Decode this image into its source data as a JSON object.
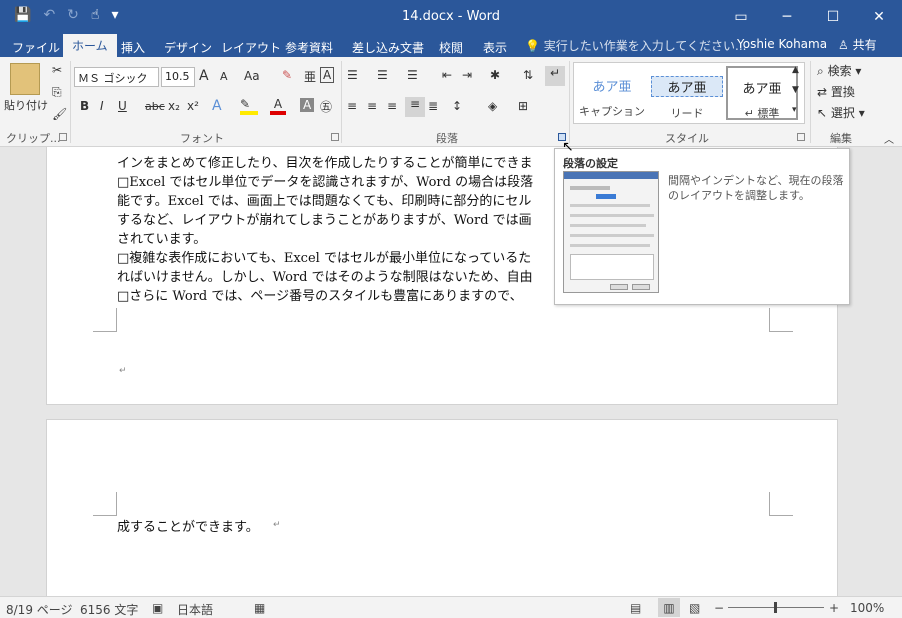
{
  "window": {
    "title": "14.docx - Word",
    "controls": [
      "▭",
      "─",
      "☐",
      "✕"
    ]
  },
  "qat": {
    "save_icon": "💾",
    "undo_icon": "↶",
    "redo_icon": "↻",
    "touch_icon": "☝",
    "customize_icon": "▾"
  },
  "tabs": [
    {
      "label": "ファイル"
    },
    {
      "label": "ホーム"
    },
    {
      "label": "挿入"
    },
    {
      "label": "デザイン"
    },
    {
      "label": "レイアウト"
    },
    {
      "label": "参考資料"
    },
    {
      "label": "差し込み文書"
    },
    {
      "label": "校閲"
    },
    {
      "label": "表示"
    }
  ],
  "tellme": "💡 実行したい作業を入力してください...",
  "user": "Yoshie Kohama",
  "share": "♙ 共有",
  "ribbon": {
    "clipboard": {
      "paste": "貼り付け",
      "label": "クリップ..."
    },
    "font": {
      "name": "ＭＳ ゴシック",
      "size": "10.5",
      "label": "フォント",
      "grow": "A",
      "shrink": "A",
      "case": "Aa",
      "bold": "B",
      "italic": "I",
      "underline": "U",
      "strike": "abc",
      "sub": "x₂",
      "sup": "x²"
    },
    "paragraph": {
      "label": "段落"
    },
    "styles": {
      "label": "スタイル",
      "items": [
        {
          "preview": "あア亜",
          "name": "キャプション"
        },
        {
          "preview": "あア亜",
          "name": "リード"
        },
        {
          "preview": "あア亜",
          "name": "↵ 標準"
        }
      ]
    },
    "editing": {
      "label": "編集",
      "find": "検索",
      "replace": "置換",
      "select": "選択"
    }
  },
  "document": {
    "lines": [
      "インをまとめて修正したり、目次を作成したりすることが簡単にできま",
      "□Excel ではセル単位でデータを認識されますが、Word の場合は段落",
      "能です。Excel では、画面上では問題なくても、印刷時に部分的にセル",
      "するなど、レイアウトが崩れてしまうことがありますが、Word では画",
      "されています。",
      "□複雑な表作成においても、Excel ではセルが最小単位になっているた",
      "ればいけません。しかし、Word ではそのような制限はないため、自由",
      "□さらに Word では、ページ番号のスタイルも豊富にありますので、"
    ],
    "page2_line": "成することができます。"
  },
  "tooltip": {
    "title": "段落の設定",
    "description": "間隔やインデントなど、現在の段落のレイアウトを調整します。"
  },
  "status": {
    "page": "8/19 ページ",
    "words": "6156 文字",
    "language": "日本語",
    "zoom": "100%"
  }
}
